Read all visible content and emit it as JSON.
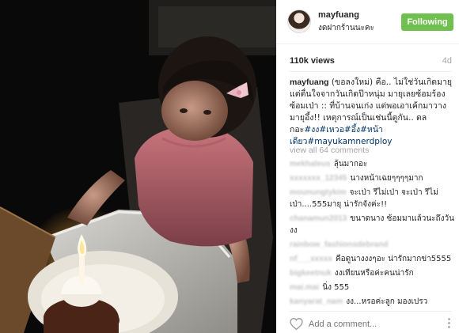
{
  "post": {
    "username": "mayfuang",
    "location": "งดฝากร้านนะคะ",
    "follow_label": "Following",
    "views": "110k views",
    "age": "4d",
    "caption": {
      "username": "mayfuang",
      "text": " (ขอลงใหม่) คือ.. ไม่ใช่วันเกิดมายุ แต่ตื่นใจจากวันเกิดป๊าหนุ่ม มายุเลยซ้อมร้อง ซ้อมเป่า :: ที่บ้านจนเก่ง แต่พอเอาเค้กมาวาง มายุอึ้ง!! เหตุการณ์เป็นเช่นนี้ตูกัน.. ตลกอะ",
      "hashtags": "#งง#เหวอ#อึ้ง#หน้าเดียว#mayukamnerdploy"
    },
    "view_all_comments": "view all 64 comments",
    "comments": [
      {
        "user": "mekhaleus",
        "text": "ลุ้นมากอะ"
      },
      {
        "user": "xxxxxxx_12345",
        "text": "นางหน้าเฉยๆๆๆๆมาก"
      },
      {
        "user": "mounungtykim",
        "text": "จะเป่า รึไม่เป่า จะเป่า รึไม่เป่า....555มายุ น่ารักจังค่ะ!!"
      },
      {
        "user": "chanamun2013",
        "text": "ขนาดนาง ซ้อมมาแล้วนะถึงวัน งง"
      },
      {
        "user": "rainbow_fashionsdebrand",
        "text": ""
      },
      {
        "user": "nf___xxxxx",
        "text": "คือดูนางงงๆอะ น่ารักมากข่า5555"
      },
      {
        "user": "bigkeetnuk",
        "text": "งงเทียนหรือค่ะคนน่ารัก"
      },
      {
        "user": "mai.mai",
        "text": "นิ่ง 555"
      },
      {
        "user": "kanyarat_nam",
        "text": "งง...หรอค่ะลูก มองเปรว"
      }
    ],
    "add_comment_placeholder": "Add a comment...",
    "icons": {
      "heart": "heart-outline-icon",
      "more": "more-options-icon"
    }
  },
  "colors": {
    "follow_button": "#70c050",
    "hashtag": "#003569",
    "muted": "#a5a7aa"
  }
}
